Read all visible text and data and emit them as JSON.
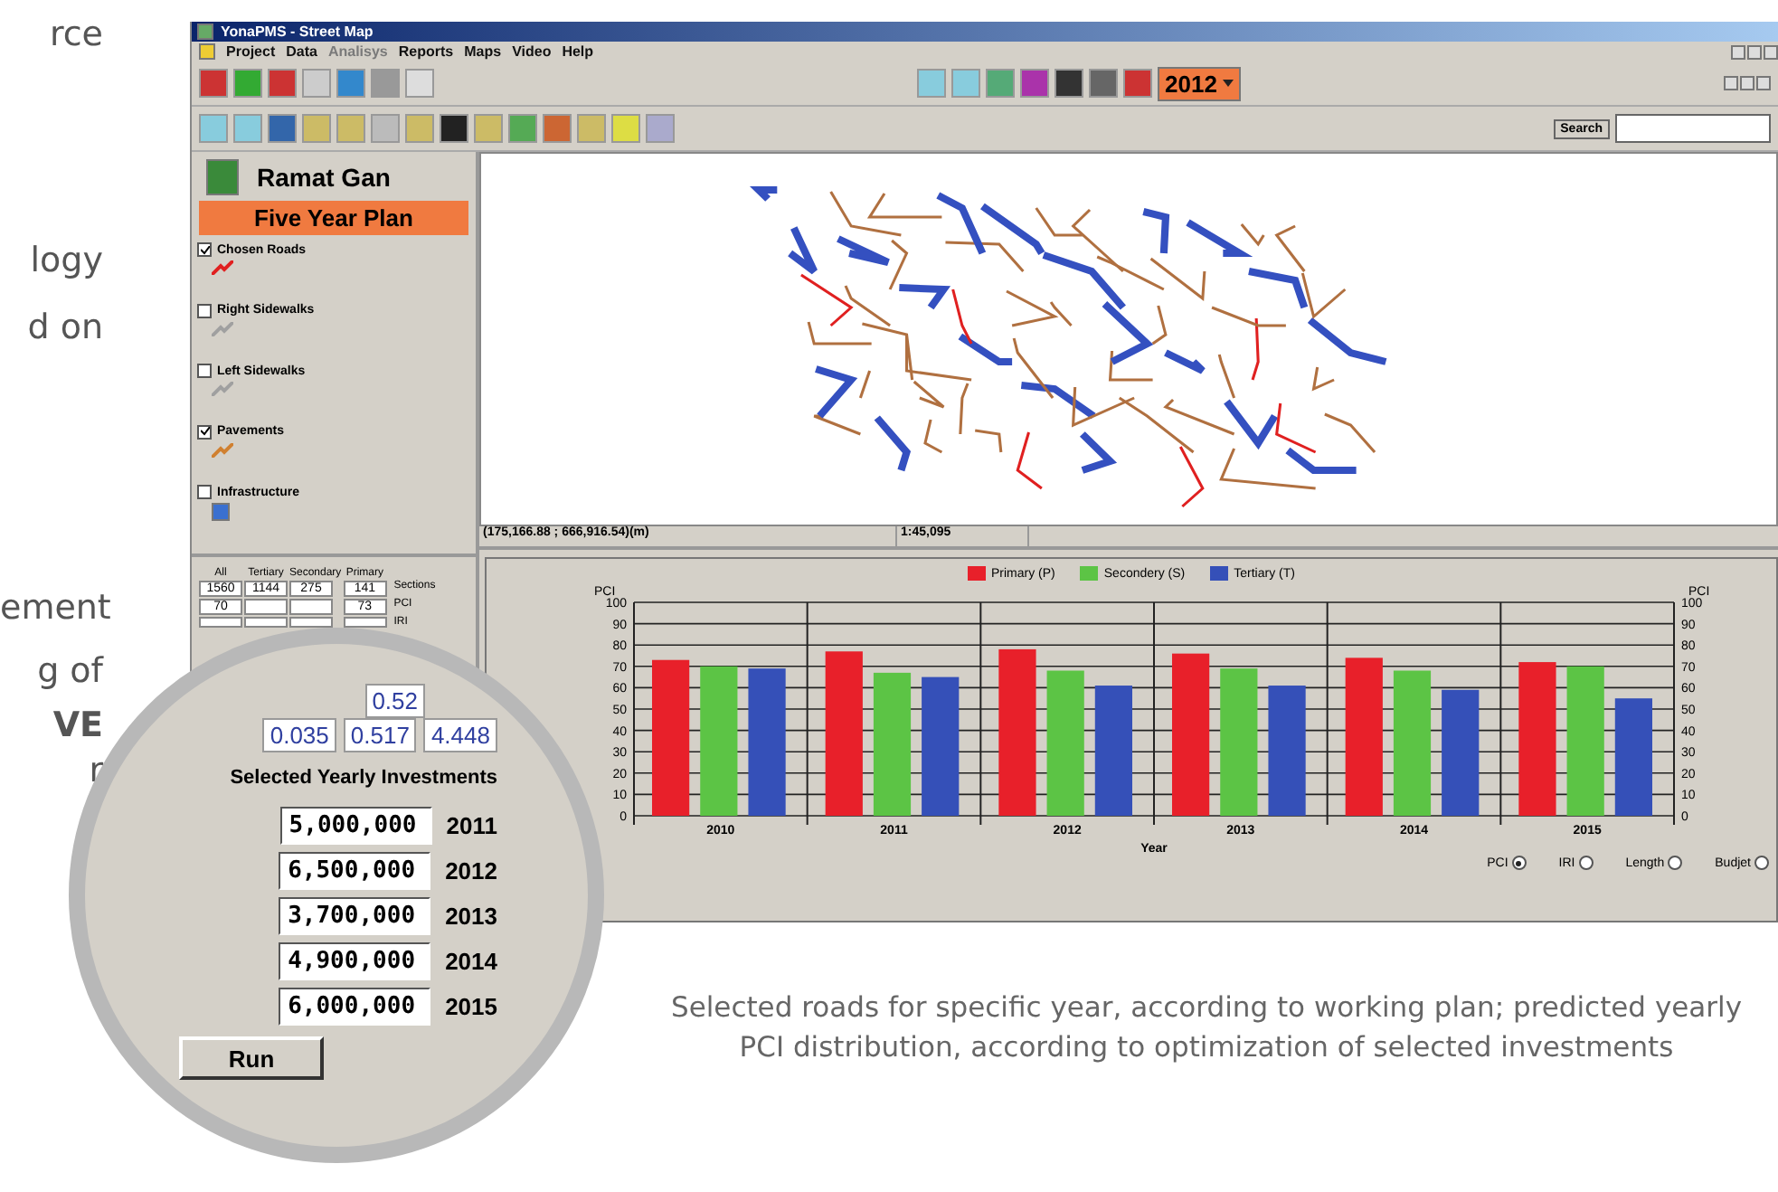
{
  "side_text": [
    {
      "text": "rce",
      "bold": false
    },
    {
      "text": "logy",
      "bold": false
    },
    {
      "text": "d on",
      "bold": false
    },
    {
      "text": "ement",
      "bold": false
    },
    {
      "text": "g of",
      "bold": false
    },
    {
      "text": "VE",
      "bold": true
    },
    {
      "text": "r",
      "bold": false
    }
  ],
  "window": {
    "title": "YonaPMS - Street Map"
  },
  "menu": [
    {
      "label": "Project",
      "disabled": false
    },
    {
      "label": "Data",
      "disabled": false
    },
    {
      "label": "Analisys",
      "disabled": true
    },
    {
      "label": "Reports",
      "disabled": false
    },
    {
      "label": "Maps",
      "disabled": false
    },
    {
      "label": "Video",
      "disabled": false
    },
    {
      "label": "Help",
      "disabled": false
    }
  ],
  "year_select": {
    "value": "2012"
  },
  "search": {
    "button": "Search"
  },
  "city": {
    "name": "Ramat Gan",
    "plan": "Five Year Plan"
  },
  "layers": [
    {
      "label": "Chosen Roads",
      "checked": true,
      "kind": "line",
      "color": "#e02020"
    },
    {
      "label": "Right Sidewalks",
      "checked": false,
      "kind": "line",
      "color": "#a0a0a0"
    },
    {
      "label": "Left Sidewalks",
      "checked": false,
      "kind": "line",
      "color": "#a0a0a0"
    },
    {
      "label": "Pavements",
      "checked": true,
      "kind": "line",
      "color": "#d08030"
    },
    {
      "label": "Infrastructure",
      "checked": false,
      "kind": "fill",
      "color": "#3a70d0"
    }
  ],
  "stats": {
    "columns": [
      "All",
      "Tertiary",
      "Secondary",
      "Primary"
    ],
    "rows": [
      {
        "cells": [
          "1560",
          "1144",
          "275",
          "141"
        ],
        "label": "Sections"
      },
      {
        "cells": [
          "70",
          null,
          null,
          "73"
        ],
        "label": "PCI"
      },
      {
        "cells": [
          null,
          null,
          null,
          null
        ],
        "label": "IRI"
      }
    ]
  },
  "status_bar": [
    "(175,166.88 ; 666,916.54)(m)",
    "1:45,095"
  ],
  "chart": {
    "right_axis": {
      "label": "PCI",
      "ticks": [
        "100",
        "90",
        "80",
        "70",
        "60",
        "50",
        "40",
        "30",
        "20",
        "10",
        "0"
      ]
    },
    "chart_data": {
      "type": "bar",
      "xlabel": "Year",
      "ylabel": "PCI",
      "categories": [
        "2010",
        "2011",
        "2012",
        "2013",
        "2014",
        "2015"
      ],
      "series": [
        {
          "name": "Primary (P)",
          "color": "#e8202a",
          "values": [
            73,
            77,
            78,
            76,
            74,
            72
          ]
        },
        {
          "name": "Secondery (S)",
          "color": "#5cc445",
          "values": [
            70,
            67,
            68,
            69,
            68,
            70
          ]
        },
        {
          "name": "Tertiary (T)",
          "color": "#3550b8",
          "values": [
            69,
            65,
            61,
            61,
            59,
            55
          ]
        }
      ],
      "ylim": [
        0,
        100
      ],
      "grid": true,
      "yticks": [
        {
          "value": 0,
          "label": "0"
        },
        {
          "value": 10,
          "label": "10"
        },
        {
          "value": 20,
          "label": "20"
        },
        {
          "value": 30,
          "label": "30"
        },
        {
          "value": 40,
          "label": "40"
        },
        {
          "value": 50,
          "label": "50"
        },
        {
          "value": 60,
          "label": "60"
        },
        {
          "value": 70,
          "label": "70"
        },
        {
          "value": 80,
          "label": "80"
        },
        {
          "value": 90,
          "label": "90"
        },
        {
          "value": 100,
          "label": "100"
        }
      ]
    }
  },
  "chart_options": [
    {
      "label": "PCI",
      "selected": true
    },
    {
      "label": "IRI",
      "selected": false
    },
    {
      "label": "Length",
      "selected": false
    },
    {
      "label": "Budjet",
      "selected": false
    }
  ],
  "magnifier": {
    "partial_row": [
      "0.52"
    ],
    "row": [
      "0.035",
      "0.517",
      "4.448"
    ],
    "title": "Selected Yearly Investments",
    "investments": [
      {
        "amount": "5,000,000",
        "year": "2011"
      },
      {
        "amount": "6,500,000",
        "year": "2012"
      },
      {
        "amount": "3,700,000",
        "year": "2013"
      },
      {
        "amount": "4,900,000",
        "year": "2014"
      },
      {
        "amount": "6,000,000",
        "year": "2015"
      }
    ],
    "run_button": "Run"
  },
  "caption": "Selected roads for specific year, according to working plan; predicted yearly PCI distribution, according to optimization of selected investments"
}
